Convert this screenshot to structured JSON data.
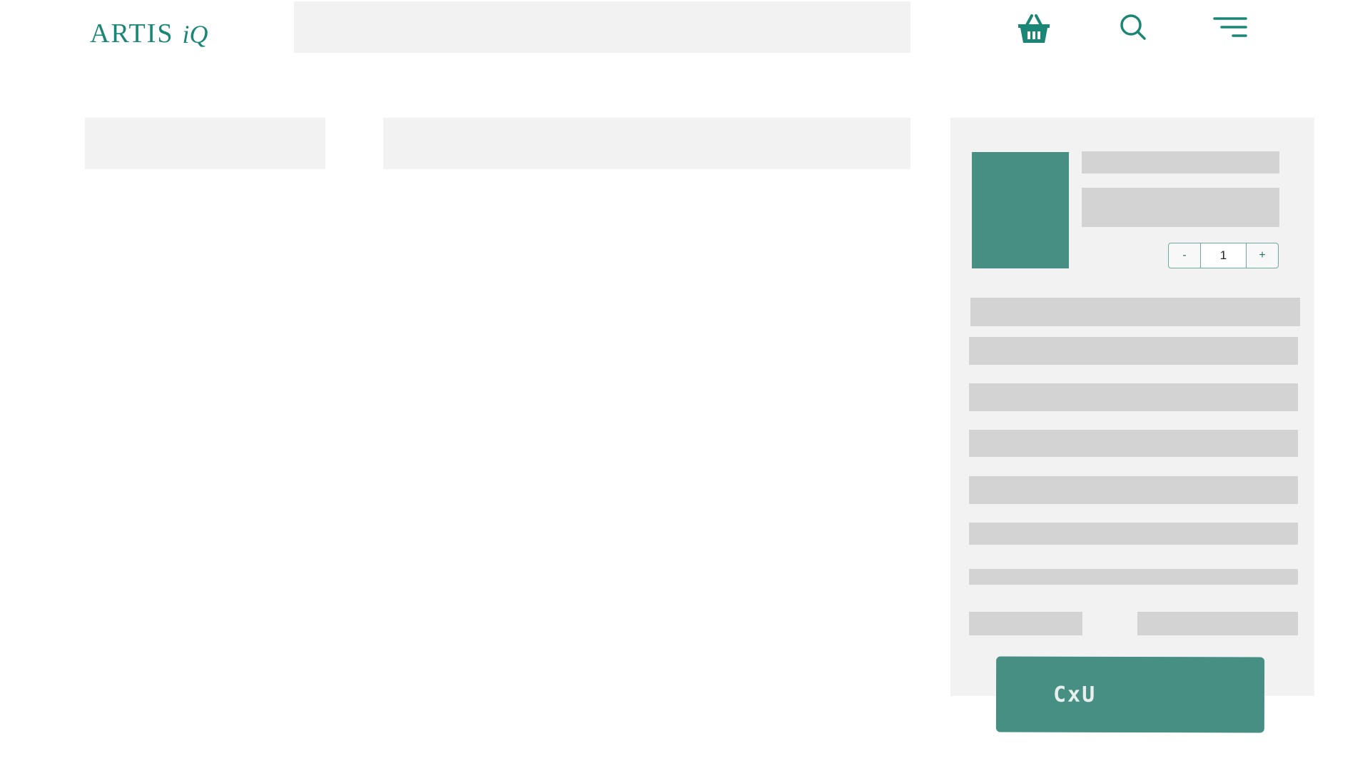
{
  "brand": {
    "logo_main": "ARTIS",
    "logo_sub": "iQ",
    "color": "#1b8676"
  },
  "header": {
    "icons": [
      "basket-icon",
      "search-icon",
      "menu-icon"
    ]
  },
  "cart": {
    "quantity": "1",
    "minus_label": "-",
    "plus_label": "+",
    "accent": "#468f82"
  },
  "checkout": {
    "label": "CxU"
  }
}
